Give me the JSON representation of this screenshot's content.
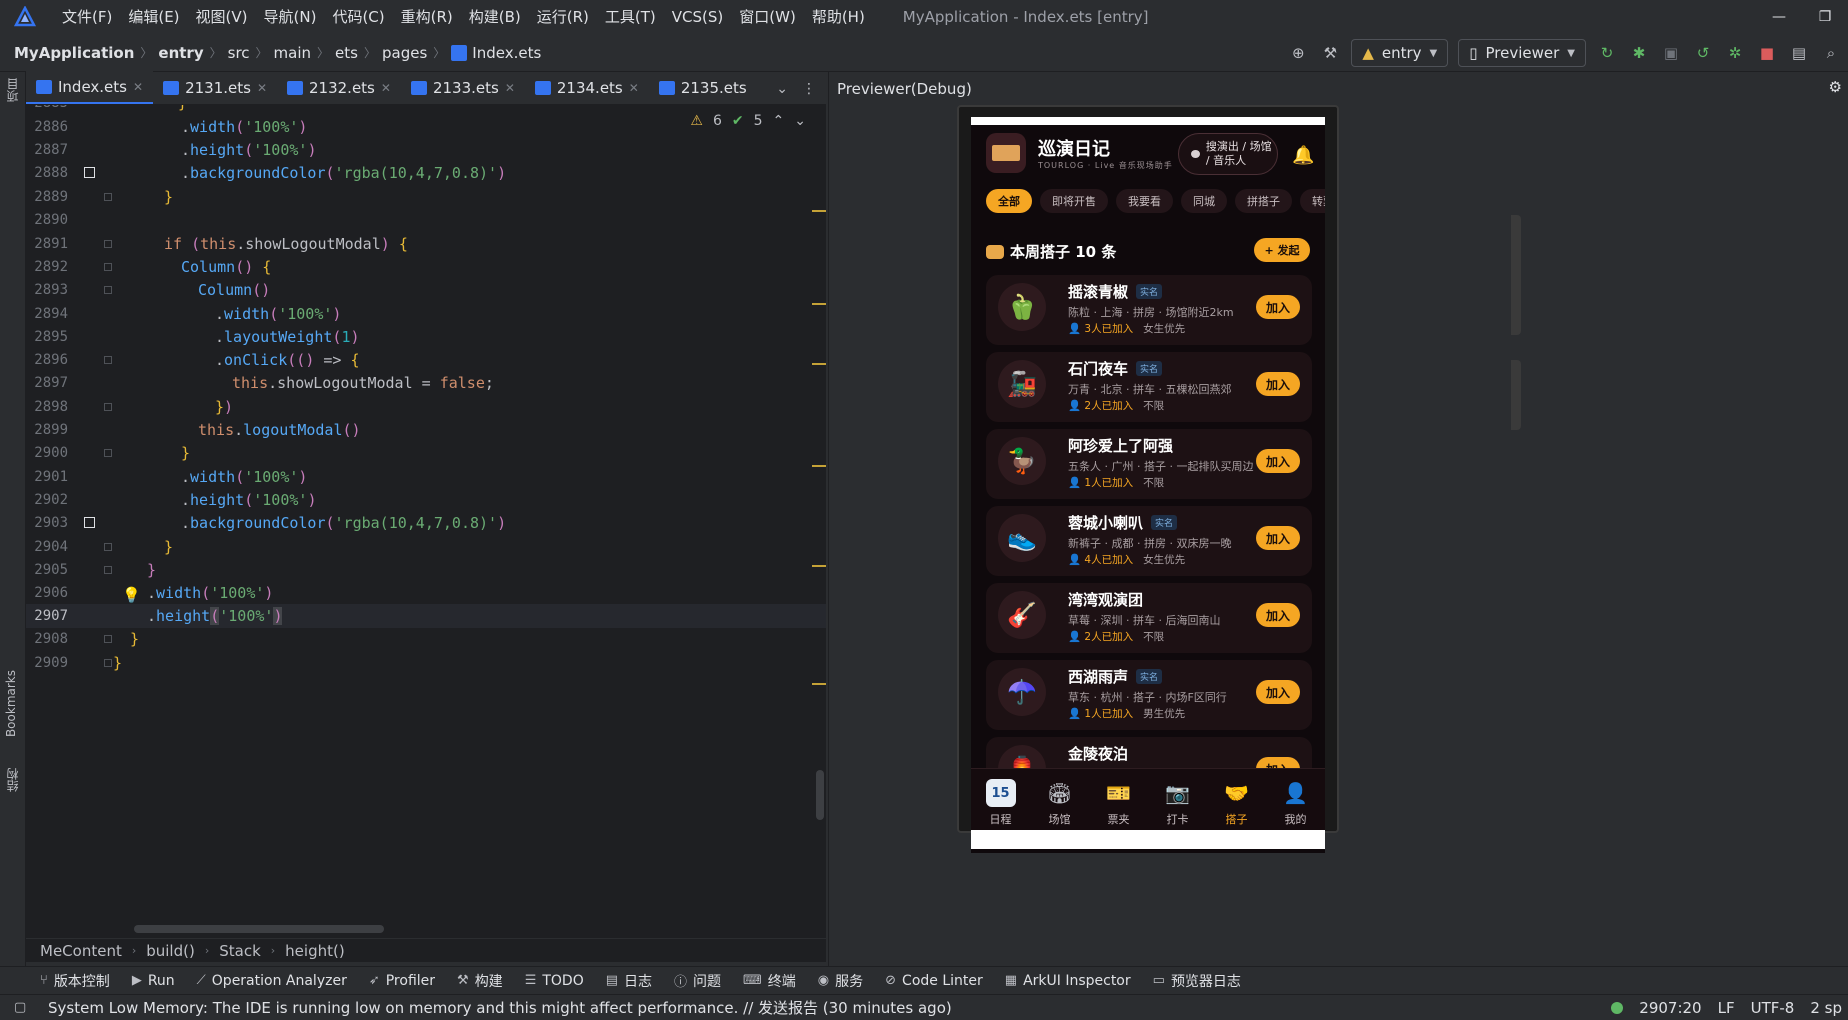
{
  "window": {
    "title": "MyApplication - Index.ets [entry]",
    "menu": [
      "文件(F)",
      "编辑(E)",
      "视图(V)",
      "导航(N)",
      "代码(C)",
      "重构(R)",
      "构建(B)",
      "运行(R)",
      "工具(T)",
      "VCS(S)",
      "窗口(W)",
      "帮助(H)"
    ]
  },
  "breadcrumb": [
    "MyApplication",
    "entry",
    "src",
    "main",
    "ets",
    "pages",
    "Index.ets"
  ],
  "toolbar": {
    "module": "entry",
    "device": "Previewer"
  },
  "left_strip": {
    "project": "项目",
    "bookmarks": "Bookmarks",
    "structure": "结构"
  },
  "tabs": [
    "Index.ets",
    "2131.ets",
    "2132.ets",
    "2133.ets",
    "2134.ets",
    "2135.ets"
  ],
  "inspections": {
    "warnings": "6",
    "ok": "5"
  },
  "code_lines": [
    {
      "n": "2885",
      "code": "}"
    },
    {
      "n": "2886",
      "code": ".width('100%')"
    },
    {
      "n": "2887",
      "code": ".height('100%')"
    },
    {
      "n": "2888",
      "code": ".backgroundColor('rgba(10,4,7,0.8)')"
    },
    {
      "n": "2889",
      "code": "}"
    },
    {
      "n": "2890",
      "code": ""
    },
    {
      "n": "2891",
      "code": "if (this.showLogoutModal) {"
    },
    {
      "n": "2892",
      "code": "Column() {"
    },
    {
      "n": "2893",
      "code": "Column()"
    },
    {
      "n": "2894",
      "code": ".width('100%')"
    },
    {
      "n": "2895",
      "code": ".layoutWeight(1)"
    },
    {
      "n": "2896",
      "code": ".onClick(() => {"
    },
    {
      "n": "2897",
      "code": "this.showLogoutModal = false;"
    },
    {
      "n": "2898",
      "code": "})"
    },
    {
      "n": "2899",
      "code": "this.logoutModal()"
    },
    {
      "n": "2900",
      "code": "}"
    },
    {
      "n": "2901",
      "code": ".width('100%')"
    },
    {
      "n": "2902",
      "code": ".height('100%')"
    },
    {
      "n": "2903",
      "code": ".backgroundColor('rgba(10,4,7,0.8)')"
    },
    {
      "n": "2904",
      "code": "}"
    },
    {
      "n": "2905",
      "code": "}"
    },
    {
      "n": "2906",
      "code": ".width('100%')"
    },
    {
      "n": "2907",
      "code": ".height('100%')"
    },
    {
      "n": "2908",
      "code": "}"
    },
    {
      "n": "2909",
      "code": "}"
    }
  ],
  "editor_breadcrumb": [
    "MeContent",
    "build()",
    "Stack",
    "height()"
  ],
  "tool_windows": [
    "版本控制",
    "Run",
    "Operation Analyzer",
    "Profiler",
    "构建",
    "TODO",
    "日志",
    "问题",
    "终端",
    "服务",
    "Code Linter",
    "ArkUI Inspector",
    "预览器日志"
  ],
  "status": {
    "message": "System Low Memory: The IDE is running low on memory and this might affect performance. // 发送报告 (30 minutes ago)",
    "position": "2907:20",
    "line_sep": "LF",
    "encoding": "UTF-8",
    "indent": "2 sp"
  },
  "previewer": {
    "title": "Previewer(Debug)"
  },
  "app": {
    "title": "巡演日记",
    "subtitle": "TOURLOG · Live 音乐现场助手",
    "search": "搜演出 / 场馆 / 音乐人",
    "chips": [
      "全部",
      "即将开售",
      "我要看",
      "同城",
      "拼搭子",
      "转票"
    ],
    "section_title": "本周搭子 10 条",
    "launch": "+ 发起",
    "join_label": "加入",
    "verified_label": "实名",
    "cards": [
      {
        "name": "摇滚青椒",
        "verified": true,
        "meta": "陈粒 · 上海 · 拼房 · 场馆附近2km",
        "joined": "3人已加入",
        "pref": "女生优先",
        "icon": "🫑"
      },
      {
        "name": "石门夜车",
        "verified": true,
        "meta": "万青 · 北京 · 拼车 · 五棵松回燕郊",
        "joined": "2人已加入",
        "pref": "不限",
        "icon": "🚂"
      },
      {
        "name": "阿珍爱上了阿强",
        "verified": false,
        "meta": "五条人 · 广州 · 搭子 · 一起排队买周边",
        "joined": "1人已加入",
        "pref": "不限",
        "icon": "🦆"
      },
      {
        "name": "蓉城小喇叭",
        "verified": true,
        "meta": "新裤子 · 成都 · 拼房 · 双床房一晚",
        "joined": "4人已加入",
        "pref": "女生优先",
        "icon": "👟"
      },
      {
        "name": "湾湾观演团",
        "verified": false,
        "meta": "草莓 · 深圳 · 拼车 · 后海回南山",
        "joined": "2人已加入",
        "pref": "不限",
        "icon": "🎸"
      },
      {
        "name": "西湖雨声",
        "verified": true,
        "meta": "草东 · 杭州 · 搭子 · 内场F区同行",
        "joined": "1人已加入",
        "pref": "男生优先",
        "icon": "☂️"
      },
      {
        "name": "金陵夜泊",
        "verified": false,
        "meta": "",
        "joined": "",
        "pref": "",
        "icon": "🏮"
      }
    ],
    "tabbar": [
      {
        "label": "日程",
        "icon": "calendar-icon"
      },
      {
        "label": "场馆",
        "icon": "stadium-icon"
      },
      {
        "label": "票夹",
        "icon": "ticket-icon"
      },
      {
        "label": "打卡",
        "icon": "camera-icon"
      },
      {
        "label": "搭子",
        "icon": "handshake-icon"
      },
      {
        "label": "我的",
        "icon": "user-icon"
      }
    ],
    "tab_active": "搭子",
    "colors": {
      "accent": "#f5a623",
      "bg": "#0f090c",
      "card": "#1d1114"
    }
  }
}
